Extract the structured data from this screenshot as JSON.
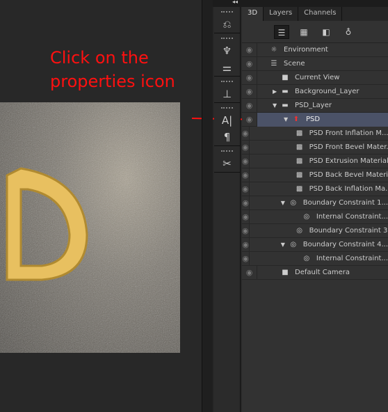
{
  "annotation": {
    "line1": "Click on the",
    "line2": "properties icon",
    "color": "#ff1010"
  },
  "panel": {
    "tabs": [
      {
        "label": "3D",
        "active": true
      },
      {
        "label": "Layers"
      },
      {
        "label": "Channels"
      }
    ],
    "filters": [
      "scene-icon",
      "mesh-icon",
      "material-icon",
      "light-icon"
    ],
    "rows": [
      {
        "label": "Environment",
        "icon": "environment-icon",
        "indent": 0,
        "tri": ""
      },
      {
        "label": "Scene",
        "icon": "scene-icon",
        "indent": 0,
        "tri": ""
      },
      {
        "label": "Current View",
        "icon": "camera-icon",
        "indent": 1,
        "tri": ""
      },
      {
        "label": "Background_Layer",
        "icon": "folder-icon",
        "indent": 1,
        "tri": "▶"
      },
      {
        "label": "PSD_Layer",
        "icon": "folder-icon",
        "indent": 1,
        "tri": "▼"
      },
      {
        "label": "PSD",
        "icon": "mesh-icon",
        "indent": 2,
        "tri": "▼",
        "selected": true
      },
      {
        "label": "PSD Front Inflation M...",
        "icon": "material-icon",
        "indent": 3,
        "tri": ""
      },
      {
        "label": "PSD Front Bevel Mater...",
        "icon": "material-icon",
        "indent": 3,
        "tri": ""
      },
      {
        "label": "PSD Extrusion Material",
        "icon": "material-icon",
        "indent": 3,
        "tri": ""
      },
      {
        "label": "PSD Back Bevel Material",
        "icon": "material-icon",
        "indent": 3,
        "tri": ""
      },
      {
        "label": "PSD Back Inflation Ma...",
        "icon": "material-icon",
        "indent": 3,
        "tri": ""
      },
      {
        "label": "Boundary Constraint 1...",
        "icon": "constraint-icon",
        "indent": 2.4,
        "tri": "▼"
      },
      {
        "label": "Internal Constraint...",
        "icon": "constraint-icon",
        "indent": 3.6,
        "tri": ""
      },
      {
        "label": "Boundary Constraint 3...",
        "icon": "constraint-icon",
        "indent": 3,
        "tri": ""
      },
      {
        "label": "Boundary Constraint 4...",
        "icon": "constraint-icon",
        "indent": 2.4,
        "tri": "▼"
      },
      {
        "label": "Internal Constraint...",
        "icon": "constraint-icon",
        "indent": 3.6,
        "tri": ""
      },
      {
        "label": "Default Camera",
        "icon": "camera-icon",
        "indent": 1,
        "tri": ""
      }
    ]
  }
}
